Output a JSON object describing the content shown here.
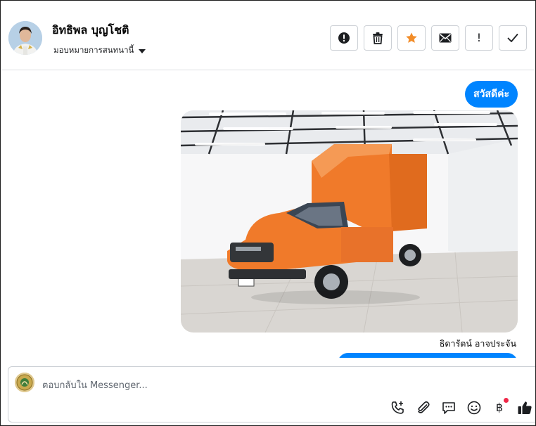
{
  "contact": {
    "name": "อิทธิพล บุญโชติ",
    "assign_label": "มอบหมายการสนทนานี้"
  },
  "header_actions": [
    {
      "icon": "alert-circle-icon"
    },
    {
      "icon": "trash-icon"
    },
    {
      "icon": "star-icon",
      "color": "#f28c28"
    },
    {
      "icon": "envelope-icon"
    },
    {
      "icon": "exclamation-icon",
      "glyph": "!"
    },
    {
      "icon": "checkmark-icon"
    }
  ],
  "messages": {
    "greeting": "สวัสดีค่ะ",
    "image_alt": "orange pickup truck with cargo box",
    "sender": "ธิดารัตน์ อาจประจัน"
  },
  "composer": {
    "placeholder": "ตอบกลับใน Messenger...",
    "tools": [
      "call-add-icon",
      "paperclip-icon",
      "chat-bubble-icon",
      "emoji-icon",
      "baht-icon",
      "thumbs-up-icon"
    ],
    "baht_glyph": "฿"
  },
  "colors": {
    "accent": "#0084ff",
    "star": "#f28c28",
    "notification_dot": "#f02849"
  }
}
